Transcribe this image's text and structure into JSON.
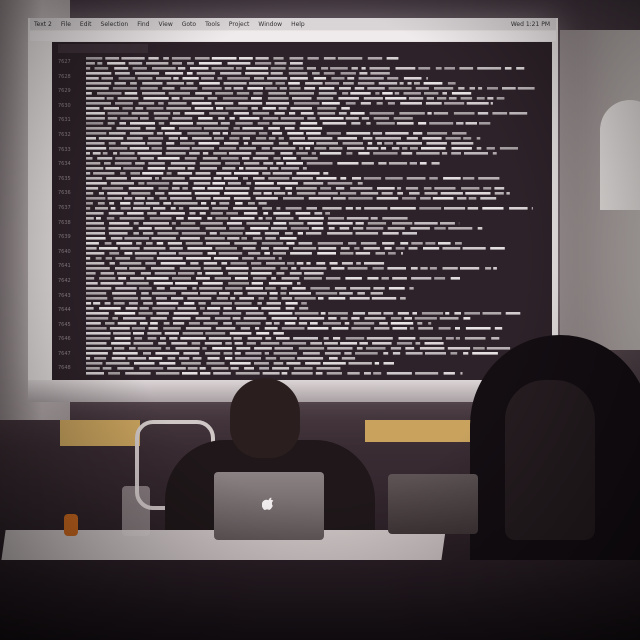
{
  "menubar": {
    "app_name": "Text 2",
    "items": [
      "File",
      "Edit",
      "Selection",
      "Find",
      "View",
      "Goto",
      "Tools",
      "Project",
      "Window",
      "Help"
    ],
    "clock": "Wed 1:21 PM"
  },
  "editor": {
    "line_numbers": [
      "7627",
      "7628",
      "7629",
      "7630",
      "7631",
      "7632",
      "7633",
      "7634",
      "7635",
      "7636",
      "7637",
      "7638",
      "7639",
      "7640",
      "7641",
      "7642",
      "7643",
      "7644",
      "7645",
      "7646",
      "7647",
      "7648"
    ]
  },
  "colors": {
    "editor_bg": "#2d2229",
    "code_text": "#e9e4e6",
    "projector_glow": "#e8e2e2",
    "mug": "#c9681f"
  },
  "icons": [
    "apple-logo-icon"
  ]
}
